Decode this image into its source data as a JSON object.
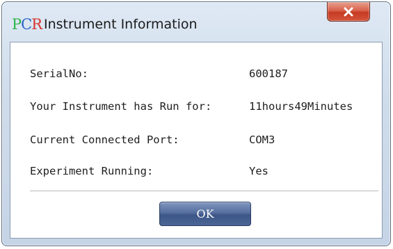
{
  "window": {
    "title": "Instrument Information",
    "icon": {
      "name": "pcr-app-icon",
      "letters": [
        "P",
        "C",
        "R"
      ]
    }
  },
  "info": {
    "serial_label": "SerialNo:",
    "serial_value": "600187",
    "runtime_label": "Your Instrument has Run for:",
    "runtime_value": "11hours49Minutes",
    "port_label": "Current Connected Port:",
    "port_value": "COM3",
    "experiment_label": "Experiment Running:",
    "experiment_value": "Yes"
  },
  "buttons": {
    "ok_label": "OK",
    "close_icon": "close-icon"
  },
  "colors": {
    "close_button": "#c53a22",
    "ok_button": "#4b6595",
    "icon_p": "#2db34a",
    "icon_c": "#2a63c7",
    "icon_r": "#d6322b"
  }
}
